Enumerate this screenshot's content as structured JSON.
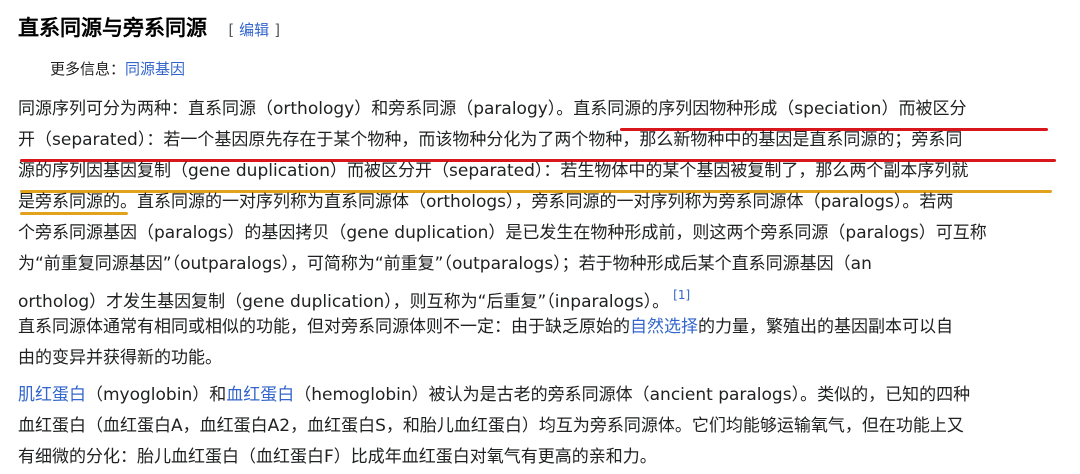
{
  "heading": {
    "title": "直系同源与旁系同源",
    "edit_open": "[",
    "edit_label": "编辑",
    "edit_close": "]"
  },
  "hatnote": {
    "prefix": "更多信息：",
    "link": "同源基因"
  },
  "para1": {
    "lines": [
      "同源序列可分为两种：直系同源（orthology）和旁系同源（paralogy）。直系同源的序列因物种形成（speciation）而被区分",
      "开（separated）：若一个基因原先存在于某个物种，而该物种分化为了两个物种，那么新物种中的基因是直系同源的；旁系同",
      "源的序列因基因复制（gene duplication）而被区分开（separated）：若生物体中的某个基因被复制了，那么两个副本序列就",
      "是旁系同源的。直系同源的一对序列称为直系同源体（orthologs），旁系同源的一对序列称为旁系同源体（paralogs）。若两",
      "个旁系同源基因（paralogs）的基因拷贝（gene duplication）是已发生在物种形成前，则这两个旁系同源（paralogs）可互称",
      "为“前重复同源基因”（outparalogs），可简称为“前重复”（outparalogs）；若于物种形成后某个直系同源基因（an",
      "ortholog）才发生基因复制（gene duplication），则互称为“后重复”（inparalogs）。"
    ],
    "ref": "[1]"
  },
  "para2": {
    "line1_pre": "直系同源体通常有相同或相似的功能，但对旁系同源体则不一定：由于缺乏原始的",
    "line1_link": "自然选择",
    "line1_post": "的力量，繁殖出的基因副本可以自",
    "line2": "由的变异并获得新的功能。"
  },
  "para3": {
    "link1": "肌红蛋白",
    "text1": "（myoglobin）和",
    "link2": "血红蛋白",
    "text2": "（hemoglobin）被认为是古老的旁系同源体（ancient paralogs）。类似的，已知的四种",
    "line2": "血红蛋白（血红蛋白A，血红蛋白A2，血红蛋白S，和胎儿血红蛋白）均互为旁系同源体。它们均能够运输氧气，但在功能上又",
    "line3": "有细微的分化：胎儿血红蛋白（血红蛋白F）比成年血红蛋白对氧气有更高的亲和力。"
  },
  "colors": {
    "link": "#3366cc",
    "red_underline": "#d9161c",
    "gold_underline": "#e2a21c"
  }
}
